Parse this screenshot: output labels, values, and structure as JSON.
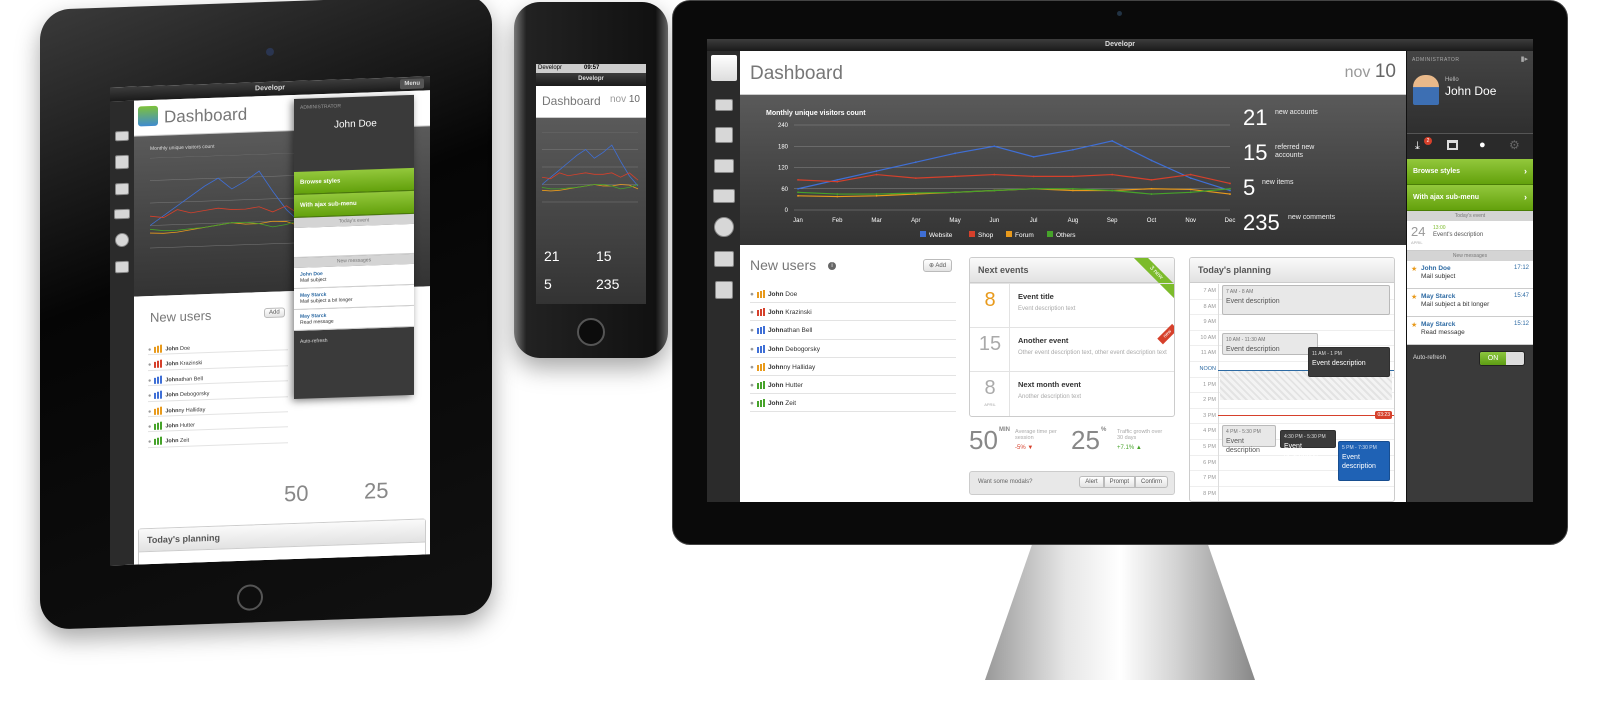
{
  "app": {
    "window_title": "Developr",
    "page_title": "Dashboard",
    "date_month": "nov",
    "date_day": "10"
  },
  "chart": {
    "title": "Monthly unique visitors count"
  },
  "chart_data": {
    "type": "line",
    "title": "Monthly unique visitors count",
    "xlabel": "",
    "ylabel": "",
    "categories": [
      "Jan",
      "Feb",
      "Mar",
      "Apr",
      "May",
      "Jun",
      "Jul",
      "Aug",
      "Sep",
      "Oct",
      "Nov",
      "Dec"
    ],
    "ylim": [
      0,
      240
    ],
    "yticks": [
      0,
      60,
      120,
      180,
      240
    ],
    "grid": true,
    "legend": "bottom",
    "series": [
      {
        "name": "Website",
        "color": "#3f6fd6",
        "values": [
          60,
          85,
          110,
          135,
          160,
          180,
          150,
          170,
          195,
          140,
          90,
          55
        ]
      },
      {
        "name": "Shop",
        "color": "#d6402b",
        "values": [
          85,
          80,
          100,
          90,
          95,
          100,
          95,
          95,
          100,
          85,
          100,
          75
        ]
      },
      {
        "name": "Forum",
        "color": "#e89a1c",
        "values": [
          40,
          38,
          40,
          45,
          50,
          55,
          60,
          55,
          55,
          60,
          58,
          45
        ]
      },
      {
        "name": "Others",
        "color": "#46a32a",
        "values": [
          50,
          45,
          45,
          48,
          50,
          55,
          60,
          60,
          55,
          45,
          50,
          60
        ]
      }
    ]
  },
  "stats": [
    {
      "num": "21",
      "label": "new accounts"
    },
    {
      "num": "15",
      "label": "referred new accounts"
    },
    {
      "num": "5",
      "label": "new items"
    },
    {
      "num": "235",
      "label": "new comments"
    }
  ],
  "new_users": {
    "title": "New users",
    "add_label": "Add",
    "users": [
      {
        "bold": "John",
        "rest": " Doe",
        "color": "#e89a1c"
      },
      {
        "bold": "John",
        "rest": " Krazinski",
        "color": "#d6402b"
      },
      {
        "bold": "John",
        "rest": "athan Bell",
        "color": "#3f6fd6"
      },
      {
        "bold": "John",
        "rest": " Debogorsky",
        "color": "#3f6fd6"
      },
      {
        "bold": "John",
        "rest": "ny Halliday",
        "color": "#e89a1c"
      },
      {
        "bold": "John",
        "rest": " Hutter",
        "color": "#46a32a"
      },
      {
        "bold": "John",
        "rest": " Zeit",
        "color": "#46a32a"
      }
    ]
  },
  "next_events": {
    "title": "Next events",
    "ribbon": "3 new",
    "events": [
      {
        "day": "8",
        "month": "",
        "title": "Event title",
        "desc": "Event description text",
        "badge": ""
      },
      {
        "day": "15",
        "month": "",
        "title": "Another event",
        "desc": "Other event description text, other event description text",
        "badge": "new"
      },
      {
        "day": "8",
        "month": "APRIL",
        "title": "Next month event",
        "desc": "Another description text",
        "badge": ""
      }
    ]
  },
  "kpis": [
    {
      "num": "50",
      "unit": "MIN",
      "label": "Average time per session",
      "delta": "-5% ▼",
      "delta_color": "#d6402b"
    },
    {
      "num": "25",
      "unit": "%",
      "label": "Traffic growth over 30 days",
      "delta": "+7.1% ▲",
      "delta_color": "#46a32a"
    }
  ],
  "modals": {
    "label": "Want some modals?",
    "buttons": [
      "Alert",
      "Prompt",
      "Confirm"
    ]
  },
  "planning": {
    "title": "Today's planning",
    "hours": [
      "7 AM",
      "8 AM",
      "9 AM",
      "10 AM",
      "11 AM",
      "NOON",
      "1 PM",
      "2 PM",
      "3 PM",
      "4 PM",
      "5 PM",
      "6 PM",
      "7 PM",
      "8 PM"
    ],
    "now_badge": "03:23",
    "blocks": [
      {
        "time": "7 AM - 8 AM",
        "desc": "Event description"
      },
      {
        "time": "10 AM - 11:30 AM",
        "desc": "Event description"
      },
      {
        "time": "11 AM - 1 PM",
        "desc": "Event description"
      },
      {
        "time": "4 PM - 5:30 PM",
        "desc": "Event description"
      },
      {
        "time": "4:30 PM - 5:30 PM",
        "desc": "Event description"
      },
      {
        "time": "5 PM - 7:30 PM",
        "desc": "Event description"
      }
    ]
  },
  "right_panel": {
    "role": "ADMINISTRATOR",
    "hello": "Hello",
    "name": "John Doe",
    "download_badge": "2",
    "menu": [
      "Browse styles",
      "With ajax sub-menu"
    ],
    "events_sep": "Today's event",
    "event": {
      "day": "24",
      "month": "APRIL",
      "time": "13:00",
      "desc": "Event's description"
    },
    "messages_sep": "New messages",
    "messages": [
      {
        "name": "John Doe",
        "subject": "Mail subject",
        "time": "17:12"
      },
      {
        "name": "May Starck",
        "subject": "Mail subject a bit longer",
        "time": "15:47"
      },
      {
        "name": "May Starck",
        "subject": "Read message",
        "time": "15:12"
      }
    ],
    "auto_refresh": "Auto-refresh",
    "toggle": "ON"
  },
  "phone": {
    "carrier": "Developr",
    "time": "09:57"
  },
  "tablet": {
    "menu": "Menu"
  }
}
